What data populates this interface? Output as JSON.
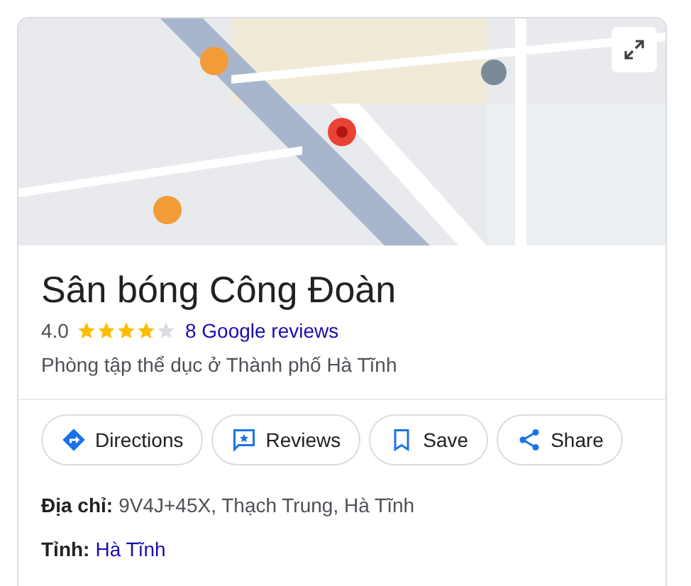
{
  "title": "Sân bóng Công Đoàn",
  "rating": {
    "value": "4.0",
    "stars": 4,
    "reviews_link": "8 Google reviews"
  },
  "category": "Phòng tập thể dục ở Thành phố Hà Tĩnh",
  "actions": [
    {
      "kind": "directions",
      "label": "Directions"
    },
    {
      "kind": "reviews",
      "label": "Reviews"
    },
    {
      "kind": "save",
      "label": "Save"
    },
    {
      "kind": "share",
      "label": "Share"
    }
  ],
  "details": [
    {
      "label": "Địa chỉ:",
      "value": "9V4J+45X, Thạch Trung, Hà Tĩnh",
      "link": false
    },
    {
      "label": "Tỉnh:",
      "value": "Hà Tĩnh",
      "link": true
    }
  ]
}
